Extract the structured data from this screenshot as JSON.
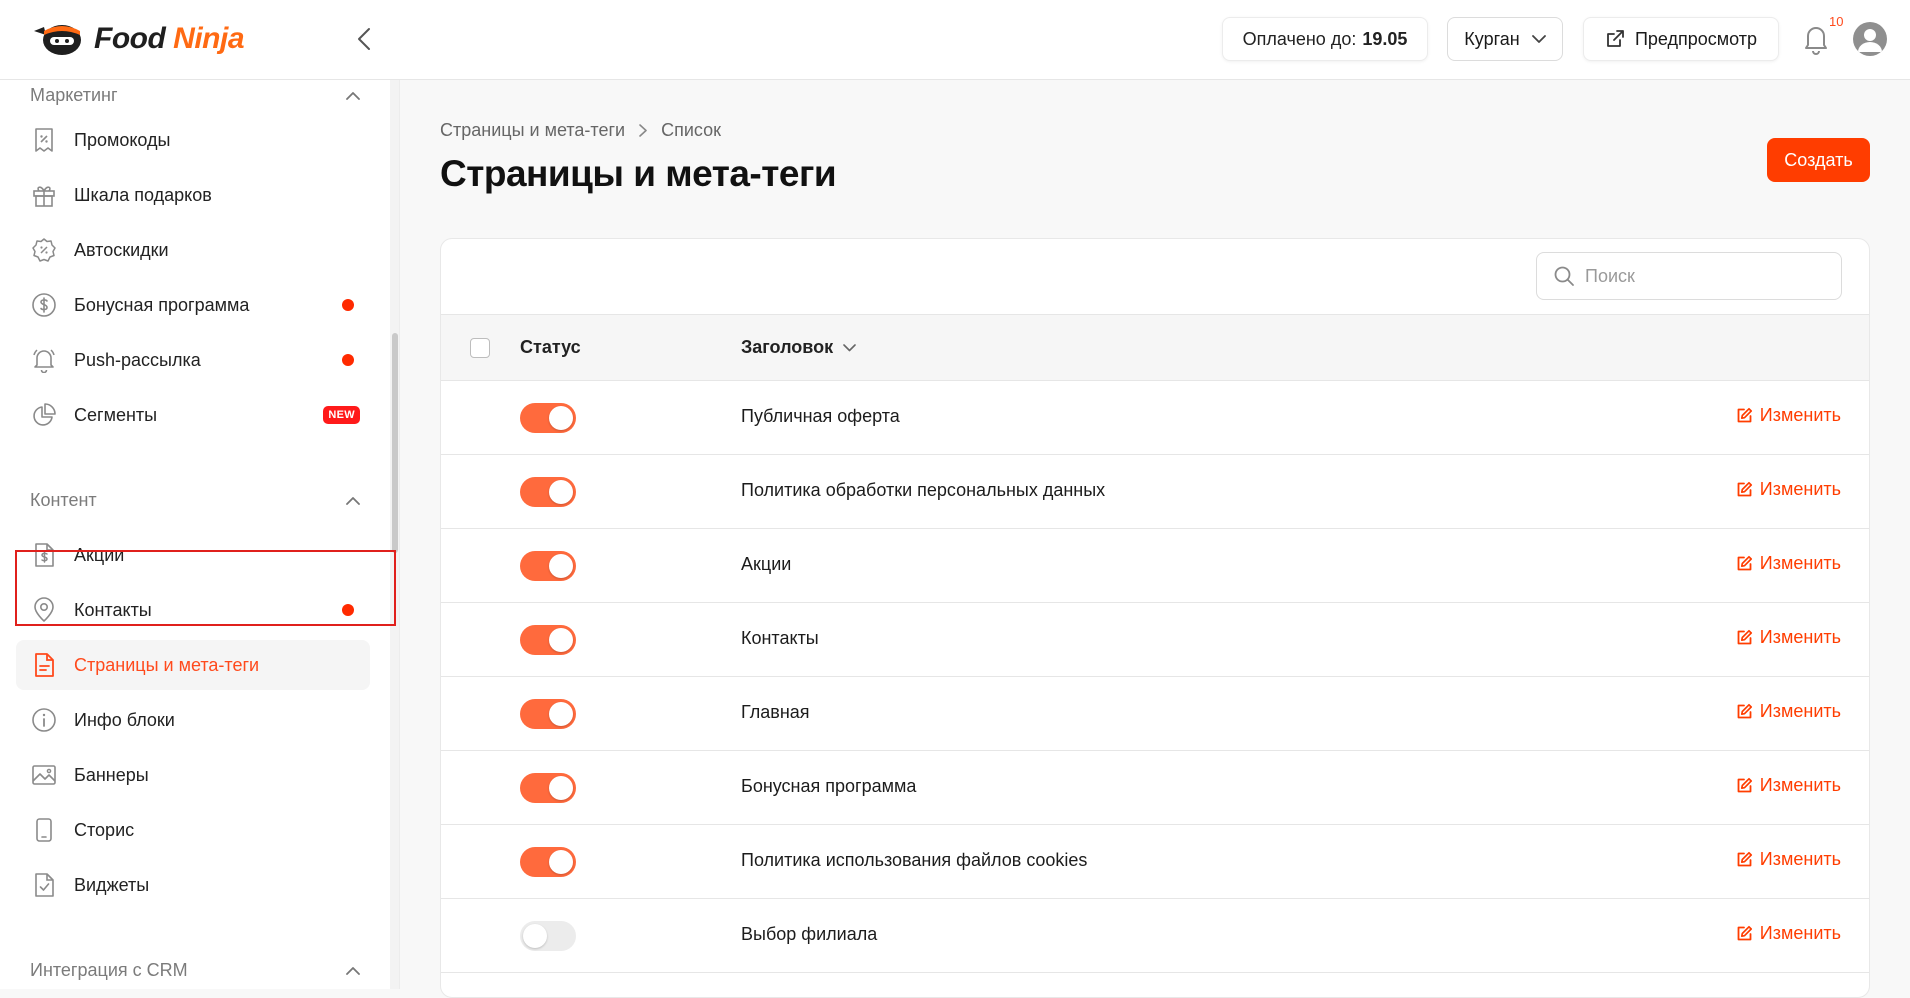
{
  "brand": {
    "name_part1": "Food",
    "name_part2": "Ninja",
    "accent": "#ff3d00"
  },
  "header": {
    "paid_label": "Оплачено до:",
    "paid_value": "19.05",
    "city": "Курган",
    "preview_label": "Предпросмотр",
    "notifications_count": "10"
  },
  "sidebar": {
    "marketing": {
      "title": "Маркетинг",
      "items": [
        {
          "label": "Промокоды",
          "icon": "coupon-icon"
        },
        {
          "label": "Шкала подарков",
          "icon": "gift-icon"
        },
        {
          "label": "Автоскидки",
          "icon": "discount-badge-icon"
        },
        {
          "label": "Бонусная программа",
          "icon": "dollar-coin-icon",
          "dot": true
        },
        {
          "label": "Push-рассылка",
          "icon": "bell-icon",
          "dot": true
        },
        {
          "label": "Сегменты",
          "icon": "pie-chart-icon",
          "badge": "NEW"
        }
      ]
    },
    "content": {
      "title": "Контент",
      "items": [
        {
          "label": "Акции",
          "icon": "dollar-file-icon"
        },
        {
          "label": "Контакты",
          "icon": "map-pin-icon",
          "dot": true
        },
        {
          "label": "Страницы и мета-теги",
          "icon": "document-icon",
          "active": true
        },
        {
          "label": "Инфо блоки",
          "icon": "info-icon"
        },
        {
          "label": "Баннеры",
          "icon": "image-icon"
        },
        {
          "label": "Сторис",
          "icon": "phone-icon"
        },
        {
          "label": "Виджеты",
          "icon": "checked-file-icon"
        }
      ]
    },
    "crm": {
      "title": "Интеграция с CRM"
    }
  },
  "main": {
    "breadcrumb": [
      "Страницы и мета-теги",
      "Список"
    ],
    "title": "Страницы и мета-теги",
    "create_label": "Создать",
    "search_placeholder": "Поиск",
    "columns": {
      "status": "Статус",
      "title": "Заголовок"
    },
    "edit_label": "Изменить",
    "rows": [
      {
        "title": "Публичная оферта",
        "enabled": true
      },
      {
        "title": "Политика обработки персональных данных",
        "enabled": true
      },
      {
        "title": "Акции",
        "enabled": true
      },
      {
        "title": "Контакты",
        "enabled": true
      },
      {
        "title": "Главная",
        "enabled": true
      },
      {
        "title": "Бонусная программа",
        "enabled": true
      },
      {
        "title": "Политика использования файлов cookies",
        "enabled": true
      },
      {
        "title": "Выбор филиала",
        "enabled": false
      }
    ]
  }
}
